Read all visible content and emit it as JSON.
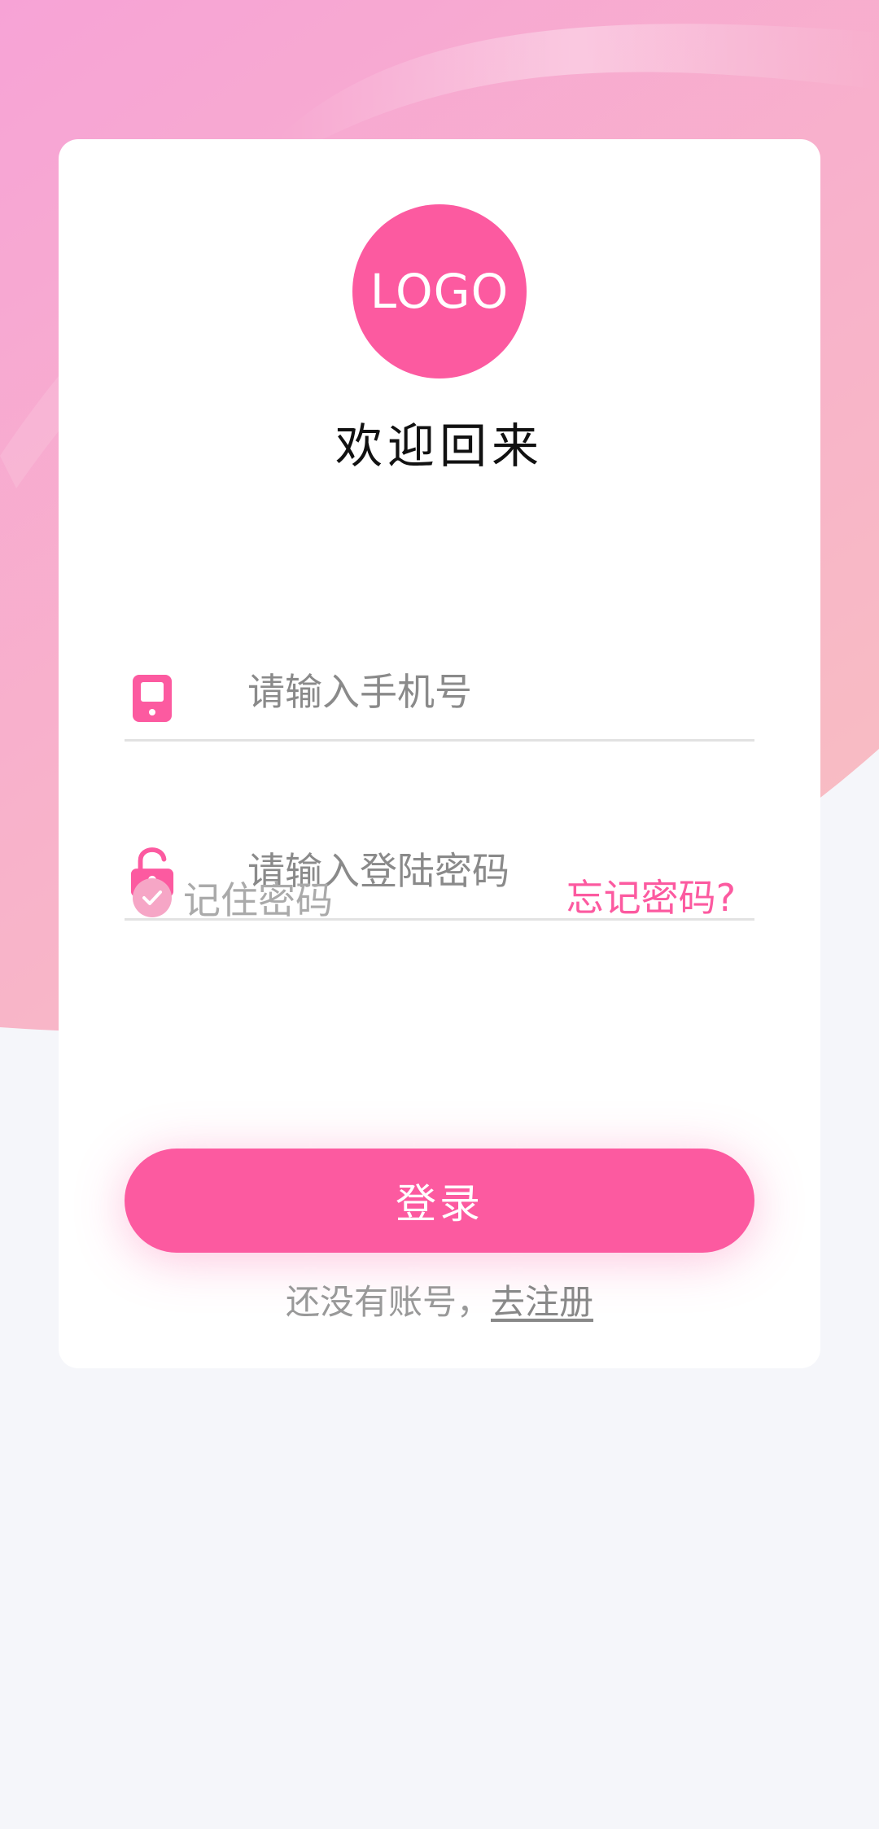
{
  "colors": {
    "accent": "#fc5aa0",
    "hero_top": "#f7a8d4",
    "hero_bottom": "#f7b9c4",
    "background": "#f5f6fa"
  },
  "logo": {
    "text": "LOGO"
  },
  "welcome_title": "欢迎回来",
  "phone_field": {
    "icon": "mobile-phone-icon",
    "placeholder": "请输入手机号",
    "value": ""
  },
  "password_field": {
    "icon": "unlock-icon",
    "placeholder": "请输入登陆密码",
    "value": ""
  },
  "remember": {
    "icon": "check-circle-icon",
    "label": "记住密码",
    "checked": true
  },
  "forgot_password": "忘记密码?",
  "login_button": "登录",
  "register": {
    "prompt": "还没有账号，",
    "link": "去注册"
  }
}
